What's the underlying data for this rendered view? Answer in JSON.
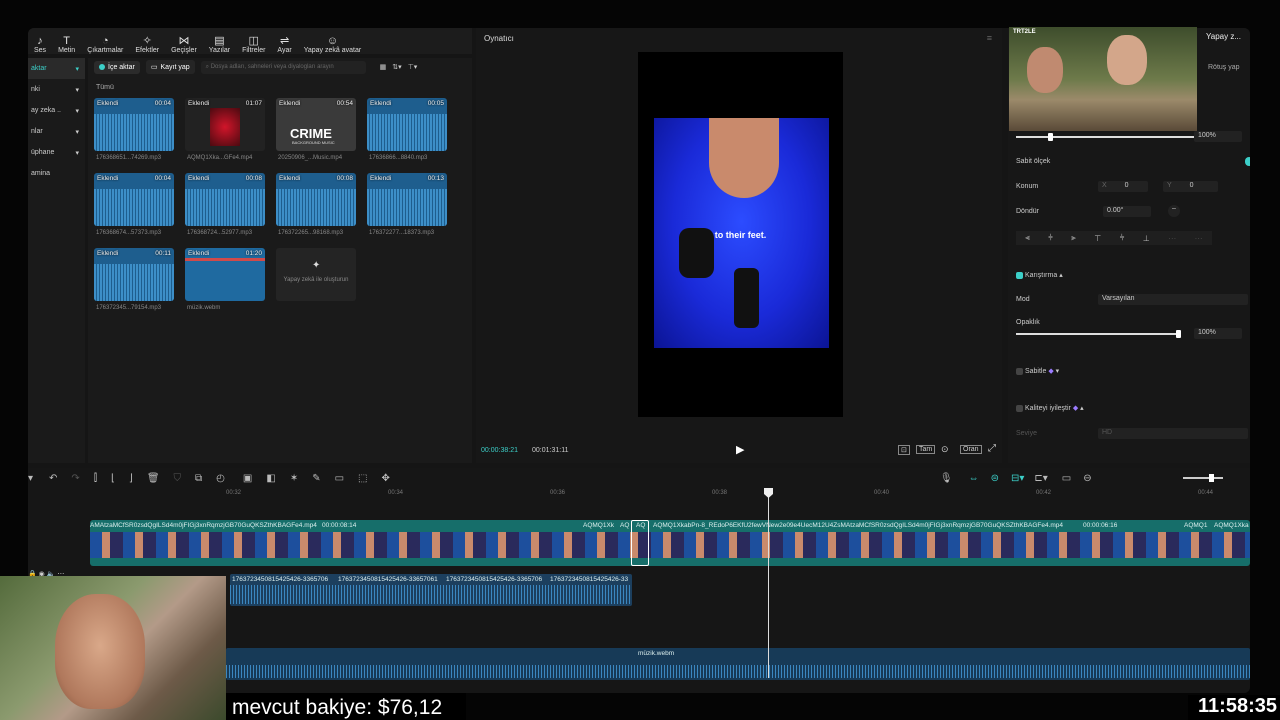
{
  "toolbar": {
    "items": [
      {
        "label": "Ses",
        "icon": "audio-icon"
      },
      {
        "label": "Metin",
        "icon": "text-icon"
      },
      {
        "label": "Çıkartmalar",
        "icon": "sticker-icon"
      },
      {
        "label": "Efektler",
        "icon": "effects-icon"
      },
      {
        "label": "Geçişler",
        "icon": "transitions-icon"
      },
      {
        "label": "Yazılar",
        "icon": "captions-icon"
      },
      {
        "label": "Filtreler",
        "icon": "filters-icon"
      },
      {
        "label": "Ayar",
        "icon": "adjust-icon"
      },
      {
        "label": "Yapay zekâ avatar",
        "icon": "ai-avatar-icon"
      }
    ]
  },
  "sidebar": {
    "items": [
      "aktar",
      "nki",
      "ay zeka ..",
      "nlar",
      "üphane",
      "amina"
    ]
  },
  "media": {
    "import_label": "İçe aktar",
    "record_label": "Kayıt yap",
    "search_placeholder": "Dosya adları, sahneleri veya diyalogları arayın",
    "section": "Tümü",
    "items": [
      {
        "badge": "Eklendi",
        "duration": "00:04",
        "name": "176368651...74269.mp3"
      },
      {
        "badge": "Eklendi",
        "duration": "01:07",
        "name": "AQMQ1Xka...GFe4.mp4"
      },
      {
        "badge": "Eklendi",
        "duration": "00:54",
        "name": "20250906_...Music.mp4",
        "thumb_text": "CRIME",
        "thumb_sub": "BACKGROUND MUSIC"
      },
      {
        "badge": "Eklendi",
        "duration": "00:05",
        "name": "17636866...8840.mp3"
      },
      {
        "badge": "Eklendi",
        "duration": "00:04",
        "name": "176368674...57373.mp3"
      },
      {
        "badge": "Eklendi",
        "duration": "00:08",
        "name": "176368724...52977.mp3"
      },
      {
        "badge": "Eklendi",
        "duration": "00:08",
        "name": "176372265...98168.mp3"
      },
      {
        "badge": "Eklendi",
        "duration": "00:13",
        "name": "176372277...18373.mp3"
      },
      {
        "badge": "Eklendi",
        "duration": "00:11",
        "name": "176372345...79154.mp3"
      },
      {
        "badge": "Eklendi",
        "duration": "01:20",
        "name": "müzik.webm"
      }
    ],
    "ai_create": "Yapay zekâ ile oluşturun"
  },
  "player": {
    "title": "Oynatıcı",
    "subtitle_text": "to their feet.",
    "current_time": "00:00:38:21",
    "total_time": "00:01:31:11",
    "ratio_btn": "Oran",
    "full_btn": "Tam"
  },
  "props": {
    "tab_ai": "Yapay z...",
    "retouch": "Rötuş yap",
    "scale_value": "100%",
    "uniform_scale": "Sabit ölçek",
    "position": "Konum",
    "pos_x_label": "X",
    "pos_x": "0",
    "pos_y_label": "Y",
    "pos_y": "0",
    "rotate": "Döndür",
    "rotate_value": "0.00°",
    "blend": "Karıştırma",
    "mode": "Mod",
    "mode_value": "Varsayılan",
    "opacity": "Opaklık",
    "opacity_value": "100%",
    "stabilize": "Sabitle",
    "enhance": "Kaliteyi iyileştir",
    "level": "Seviye",
    "level_value": "HD",
    "cam_logo": "TRT2LE"
  },
  "timeline": {
    "ruler": [
      "00:32",
      "00:34",
      "00:36",
      "00:38",
      "00:40",
      "00:42",
      "00:44"
    ],
    "main_clip_a": "AMAtzaMCfSR0zsdQgILSd4m0jFIGj3xnRqmzjGB70GuQKSZthKBAGFe4.mp4",
    "main_clip_a_dur": "00:00:08:14",
    "main_clip_b": "AQMQ1Xk",
    "main_clip_c": "AQ",
    "main_clip_d": "AQ",
    "main_clip_e": "AQMQ1XkabPn-8_REdoP6EKfU2fewVNew2e09e4UecM12U4ZsMAtzaMCfSR0zsdQgILSd4m0jFIGj3xnRqmzjGB70GuQKSZthKBAGFe4.mp4",
    "main_clip_e_dur": "00:00:06:16",
    "main_clip_f": "AQMQ1",
    "main_clip_g": "AQMQ1Xka",
    "audio_clips": [
      "176372345081542542​6-3365706",
      "17637234508154254​26-33657061",
      "1763723450815425426-3365706",
      "1763723450815425426-33"
    ],
    "music_clip": "müzik.webm"
  },
  "overlay": {
    "balance": "mevcut bakiye: $76,12",
    "clock": "11:58:35"
  }
}
